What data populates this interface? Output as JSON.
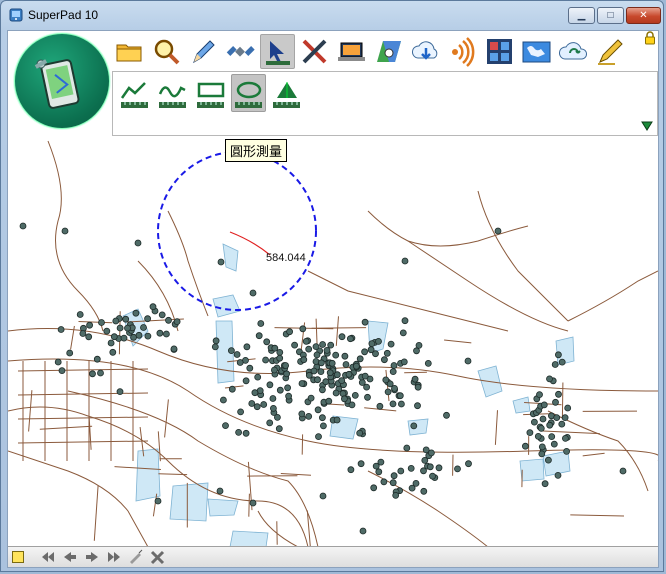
{
  "window": {
    "title": "SuperPad 10",
    "controls": {
      "minimize": "▁",
      "maximize": "□",
      "close": "✕"
    }
  },
  "toolbar": {
    "items": [
      {
        "name": "open-folder-icon"
      },
      {
        "name": "search-zoom-icon"
      },
      {
        "name": "edit-pencil-icon"
      },
      {
        "name": "satellite-gps-icon"
      },
      {
        "name": "measure-tools-icon",
        "active": true
      },
      {
        "name": "tools-cross-icon"
      },
      {
        "name": "laptop-icon"
      },
      {
        "name": "map-view-icon"
      },
      {
        "name": "cloud-download-icon"
      },
      {
        "name": "signal-broadcast-icon"
      },
      {
        "name": "grid-layout-icon"
      },
      {
        "name": "world-map-icon"
      },
      {
        "name": "cloud-sync-icon"
      },
      {
        "name": "pen-note-icon"
      }
    ]
  },
  "measure_panel": {
    "tools": [
      {
        "name": "polyline-distance-icon"
      },
      {
        "name": "curve-distance-icon"
      },
      {
        "name": "rectangle-measure-icon"
      },
      {
        "name": "circle-measure-icon",
        "active": true
      },
      {
        "name": "angle-measure-icon"
      }
    ]
  },
  "tooltip": {
    "text": "圓形測量"
  },
  "measurement": {
    "value": "584.044"
  },
  "colors": {
    "road": "#8b5a3c",
    "water": "#cfe8f6",
    "point": "#4f6b67",
    "circle": "#1a1ae6",
    "measure_line": "#e02020",
    "toolbar_active": "#c9c9c9"
  },
  "statusbar": {
    "buttons": [
      {
        "name": "first-page-icon"
      },
      {
        "name": "previous-icon"
      },
      {
        "name": "next-icon"
      },
      {
        "name": "last-page-icon"
      },
      {
        "name": "select-edit-icon"
      },
      {
        "name": "close-x-icon"
      }
    ]
  }
}
